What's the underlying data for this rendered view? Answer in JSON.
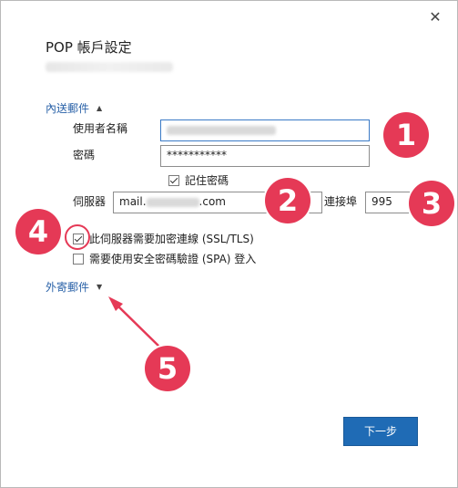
{
  "dialog": {
    "title": "POP 帳戶設定",
    "close_label": "✕"
  },
  "incoming": {
    "section_label": "內送郵件",
    "username_label": "使用者名稱",
    "password_label": "密碼",
    "password_value": "***********",
    "remember_password_label": "記住密碼",
    "remember_password_checked": true,
    "server_label": "伺服器",
    "server_prefix": "mail.",
    "server_suffix": ".com",
    "port_label": "連接埠",
    "port_value": "995",
    "ssl_label": "此伺服器需要加密連線 (SSL/TLS)",
    "ssl_checked": true,
    "spa_label": "需要使用安全密碼驗證 (SPA) 登入",
    "spa_checked": false
  },
  "outgoing": {
    "section_label": "外寄郵件"
  },
  "buttons": {
    "next_label": "下一步"
  },
  "annotations": {
    "color": "#e53956",
    "badges": [
      "1",
      "2",
      "3",
      "4",
      "5"
    ]
  }
}
